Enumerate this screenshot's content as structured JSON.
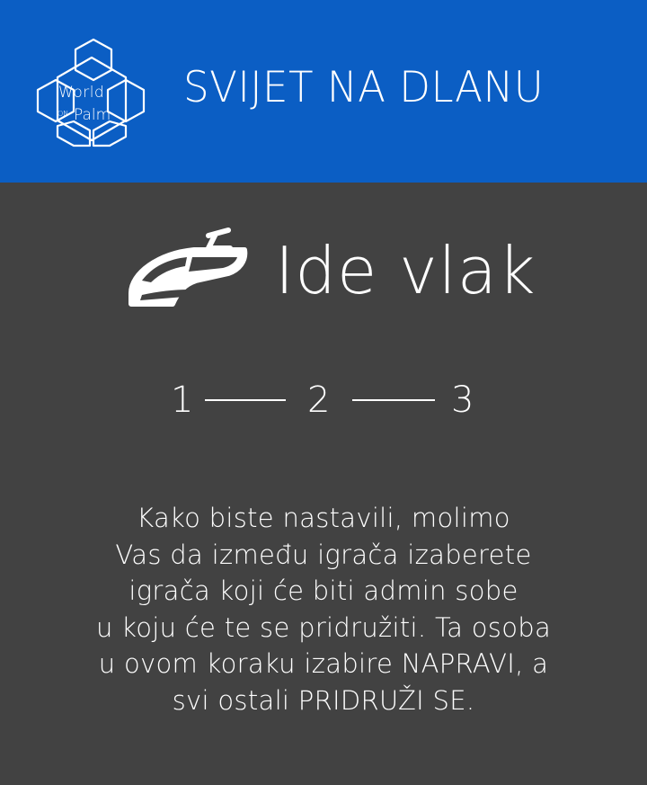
{
  "header": {
    "logo": {
      "icon": "world-on-palm-hexagon-logo",
      "word_world": "World",
      "word_on": "ON",
      "word_palm": "Palm"
    },
    "title": "SVIJET NA DLANU",
    "background_color": "#0b5ec4"
  },
  "main": {
    "background_color": "#424242",
    "game": {
      "icon": "train-icon",
      "title": "Ide vlak"
    },
    "steps": {
      "items": [
        "1",
        "2",
        "3"
      ]
    },
    "instructions": {
      "lines": [
        "Kako biste nastavili, molimo",
        "Vas da između igrača izaberete",
        "igrača koji će biti admin sobe",
        "u koju će te se pridružiti. Ta osoba",
        "u ovom koraku izabire NAPRAVI, a",
        "svi ostali PRIDRUŽI SE."
      ]
    }
  }
}
